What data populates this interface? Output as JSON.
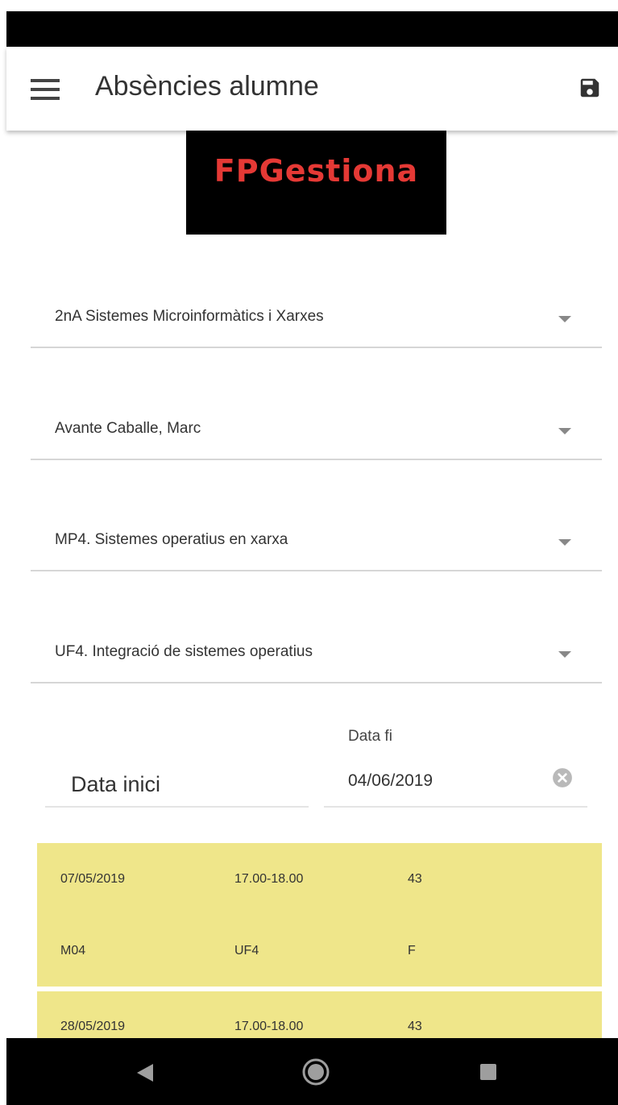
{
  "header": {
    "title": "Absències alumne"
  },
  "logo": {
    "text": "FPGestiona",
    "text_color": "#e53935",
    "background": "#000000"
  },
  "filters": {
    "group": "2nA Sistemes Microinformàtics i Xarxes",
    "student": "Avante Caballe, Marc",
    "module": "MP4. Sistemes operatius en xarxa",
    "unit": "UF4. Integració de sistemes operatius"
  },
  "dates": {
    "start_placeholder": "Data inici",
    "end_label": "Data fi",
    "end_value": "04/06/2019"
  },
  "records": [
    {
      "date": "07/05/2019",
      "time": "17.00-18.00",
      "number": "43",
      "module": "M04",
      "unit": "UF4",
      "type": "F"
    },
    {
      "date": "28/05/2019",
      "time": "17.00-18.00",
      "number": "43"
    }
  ],
  "colors": {
    "record_background": "#efe68a",
    "accent": "#e53935"
  },
  "icons": {
    "menu": "menu-icon",
    "save": "save-icon",
    "clear": "clear-icon",
    "back": "back-icon",
    "home": "home-icon",
    "recents": "recents-icon"
  }
}
